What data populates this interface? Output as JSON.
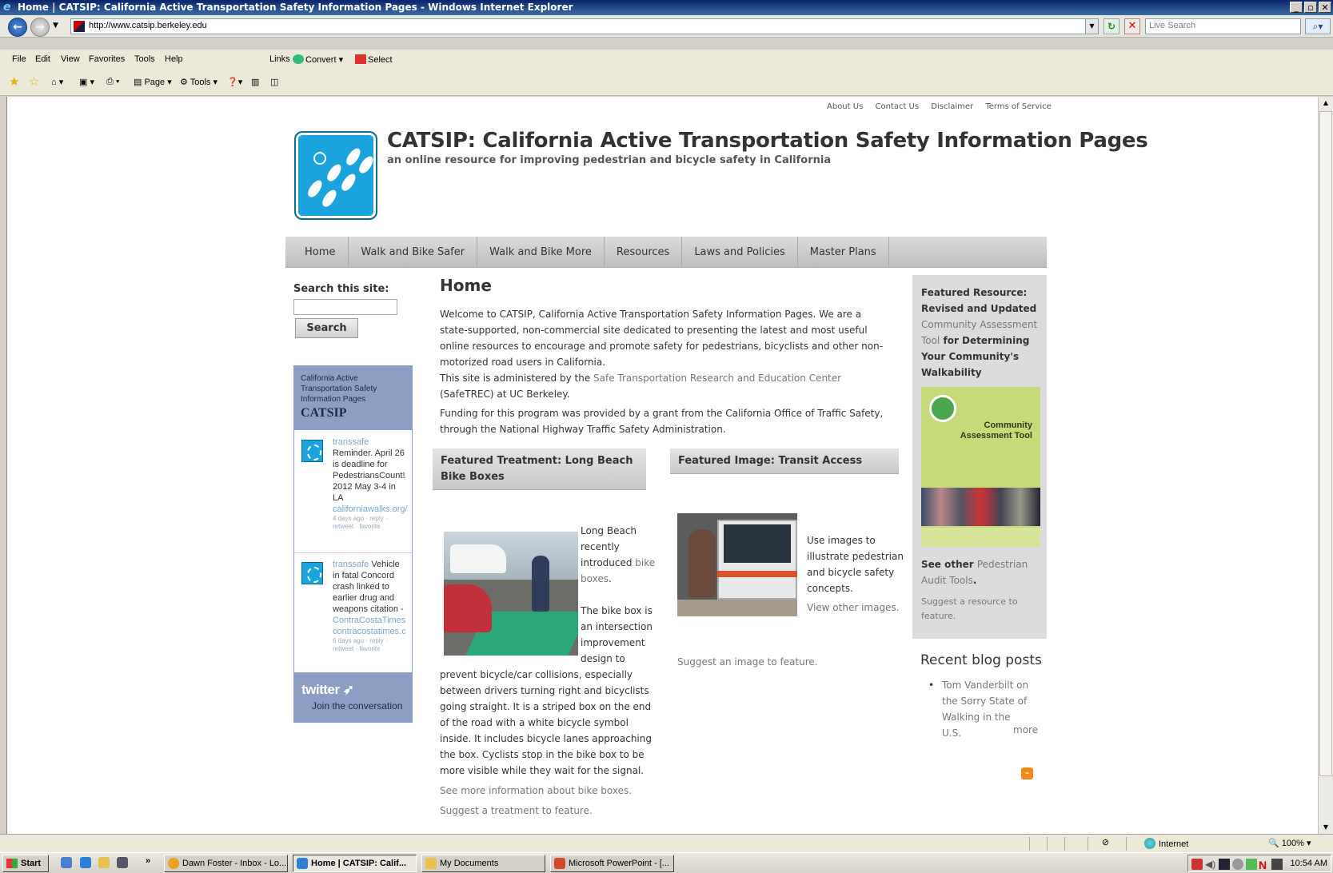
{
  "window": {
    "title": "Home | CATSIP: California Active Transportation Safety Information Pages - Windows Internet Explorer",
    "buttons": [
      "_",
      "▫",
      "✕"
    ]
  },
  "addressbar": {
    "url": "http://www.catsip.berkeley.edu",
    "search_placeholder": "Live Search"
  },
  "menubar": {
    "items": [
      "File",
      "Edit",
      "View",
      "Favorites",
      "Tools",
      "Help"
    ],
    "links_label": "Links",
    "convert_label": "Convert",
    "select_label": "Select"
  },
  "commandbar": {
    "page_label": "Page",
    "tools_label": "Tools"
  },
  "site": {
    "top_links": [
      "About Us",
      "Contact Us",
      "Disclaimer",
      "Terms of Service"
    ],
    "title": "CATSIP: California Active Transportation Safety Information Pages",
    "subtitle": "an online resource for improving pedestrian and bicycle safety in California",
    "nav": [
      "Home",
      "Walk and Bike Safer",
      "Walk and Bike More",
      "Resources",
      "Laws and Policies",
      "Master Plans"
    ],
    "search": {
      "label": "Search this site:",
      "button": "Search"
    },
    "twitter": {
      "header_small": "California Active Transportation Safety Information Pages",
      "header_big": "CATSIP",
      "tweets": [
        {
          "user": "transsafe",
          "text": "Reminder. April 26 is deadline for PedestriansCount! 2012 May 3-4 in LA",
          "link": "californiawalks.org/",
          "meta": "4 days ago · reply · retweet · favorite"
        },
        {
          "user": "transsafe",
          "text": "Vehicle in fatal Concord crash linked to earlier drug and weapons citation -",
          "link": "ContraCostaTimes",
          "link2": "contracostatimes.c",
          "meta": "6 days ago · reply · retweet · favorite"
        }
      ],
      "logo": "twitter",
      "join": "Join the conversation"
    },
    "main": {
      "heading": "Home",
      "p1": "Welcome to CATSIP, California Active Transportation Safety Information Pages. We are a state-supported, non-commercial site dedicated to presenting the latest and most useful online resources to encourage and promote safety for pedestrians, bicyclists and other non-motorized road users in California.",
      "p2_pre": "This site is administered by the ",
      "p2_link": "Safe Transportation Research and Education Center",
      "p2_post": " (SafeTREC) at UC Berkeley.",
      "p3": "Funding for this program was provided by a grant from the California Office of Traffic Safety, through the National Highway Traffic Safety Administration."
    },
    "featured_treatment": {
      "heading": "Featured Treatment: Long Beach Bike Boxes",
      "t1_pre": "Long Beach recently introduced ",
      "t1_link": "bike boxes",
      "t1_post": ".",
      "t2": "The bike box is an intersection improvement design to prevent bicycle/car collisions, especially between drivers turning right and bicyclists going straight. It is a striped box on the end of the road with a white bicycle symbol inside. It includes bicycle lanes approaching the box. Cyclists stop in the bike box to be more visible while they wait for the signal.",
      "more_link": "See more information about bike boxes.",
      "suggest_link": "Suggest a treatment to feature."
    },
    "featured_image": {
      "heading": "Featured Image: Transit Access",
      "text": "Use images to illustrate pedestrian and bicycle safety concepts.",
      "view_link": "View other images.",
      "suggest_link": "Suggest an image to feature."
    },
    "featured_resource": {
      "h_pre": "Featured Resource: Revised and Updated ",
      "h_link": "Community Assessment Tool",
      "h_post": " for Determining Your Community's Walkability",
      "cover_title_1": "Community",
      "cover_title_2": "Assessment Tool",
      "other_pre": "See other ",
      "other_link": "Pedestrian Audit Tools",
      "other_post": ".",
      "suggest": "Suggest a resource to feature."
    },
    "blog": {
      "heading": "Recent blog posts",
      "items": [
        "Tom Vanderbilt on the Sorry State of Walking in the U.S."
      ],
      "more": "more"
    }
  },
  "statusbar": {
    "zone": "Internet",
    "zoom": "100%"
  },
  "taskbar": {
    "start": "Start",
    "tasks": [
      "Dawn Foster - Inbox - Lo...",
      "Home | CATSIP: Calif...",
      "My Documents",
      "Microsoft PowerPoint - [..."
    ],
    "clock": "10:54 AM"
  },
  "colors": {
    "accent_blue": "#1aa3dc",
    "link_gray": "#777777",
    "twitter_panel": "#8d9ec4"
  }
}
